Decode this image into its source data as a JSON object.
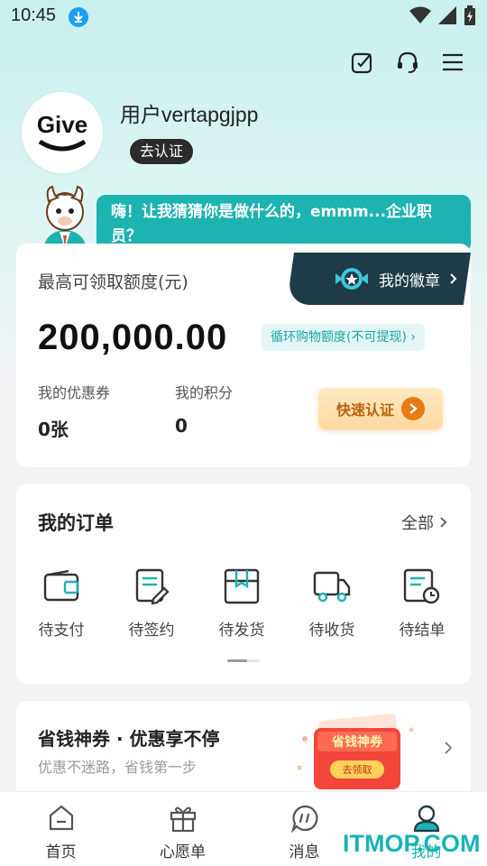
{
  "status_bar": {
    "time": "10:45"
  },
  "profile": {
    "username": "用户vertapgjpp",
    "verify_label": "去认证",
    "avatar_text": "Give"
  },
  "bubble": {
    "text": "嗨！让我猜猜你是做什么的，emmm...企业职员？"
  },
  "quota": {
    "title": "最高可领取额度(元)",
    "badge_label": "我的徽章",
    "amount": "200,000.00",
    "cycle_tag": "循环购物额度(不可提现)",
    "coupon_label": "我的优惠券",
    "coupon_value": "0张",
    "points_label": "我的积分",
    "points_value": "0",
    "quick_button": "快速认证"
  },
  "orders": {
    "title": "我的订单",
    "all_label": "全部",
    "items": [
      {
        "label": "待支付",
        "icon": "wallet-icon"
      },
      {
        "label": "待签约",
        "icon": "sign-document-icon"
      },
      {
        "label": "待发货",
        "icon": "box-icon"
      },
      {
        "label": "待收货",
        "icon": "truck-icon"
      },
      {
        "label": "待结单",
        "icon": "clock-document-icon"
      }
    ]
  },
  "promo": {
    "title": "省钱神券 · 优惠享不停",
    "subtitle": "优惠不迷路，省钱第一步",
    "image_title": "省钱神券",
    "image_button": "去领取"
  },
  "nav": {
    "items": [
      {
        "label": "首页",
        "icon": "home-icon"
      },
      {
        "label": "心愿单",
        "icon": "gift-icon"
      },
      {
        "label": "消息",
        "icon": "message-icon"
      },
      {
        "label": "我的",
        "icon": "user-icon"
      }
    ],
    "active_index": 3
  },
  "watermark": "ITMOP.COM",
  "colors": {
    "accent": "#1cb3b1",
    "dark_tab": "#1e3b47",
    "orange": "#e77b14"
  }
}
